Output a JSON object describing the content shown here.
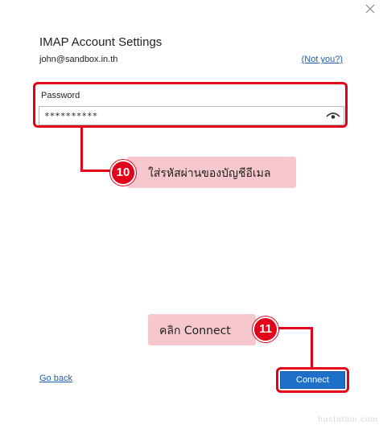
{
  "dialog": {
    "title": "IMAP Account Settings",
    "email": "john@sandbox.in.th",
    "not_you_link": "(Not you?)",
    "close_icon": "close-icon"
  },
  "password": {
    "label": "Password",
    "value": "**********",
    "reveal_icon": "eye-icon"
  },
  "annotations": {
    "step10": {
      "number": "10",
      "text": "ใส่รหัสผ่านของบัญชีอีเมล"
    },
    "step11": {
      "number": "11",
      "text": "คลิก Connect"
    },
    "highlight_color": "#e2001a",
    "callout_color": "#f6c8cd"
  },
  "footer": {
    "go_back": "Go back",
    "connect": "Connect",
    "connect_color": "#1e6fc7"
  },
  "watermark": "hostatom.com"
}
